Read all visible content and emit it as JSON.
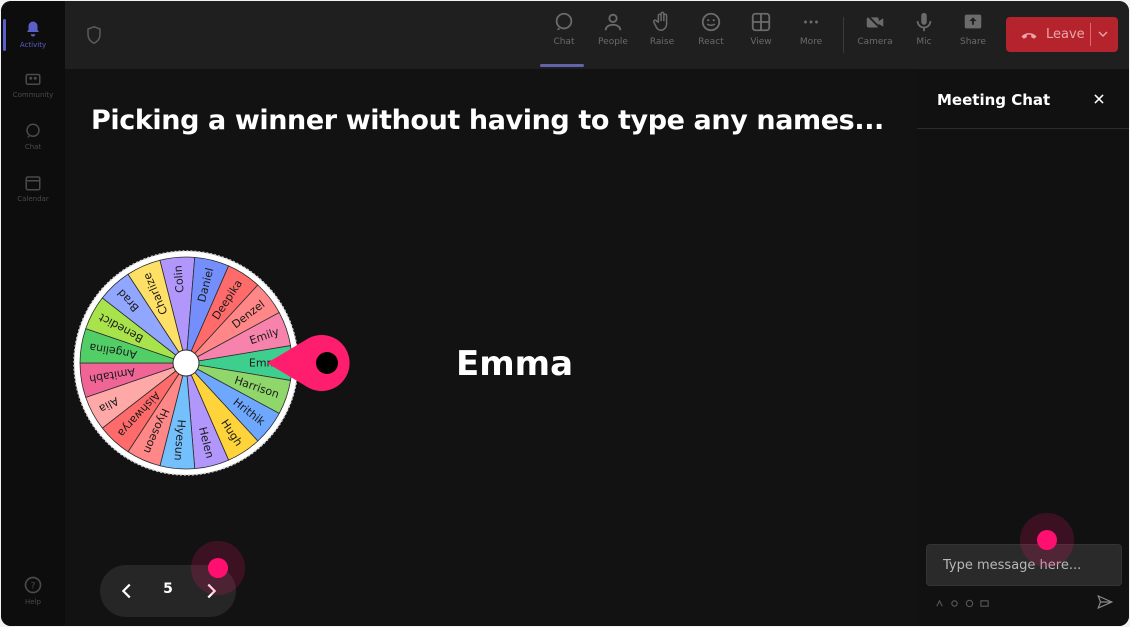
{
  "rail": {
    "items": [
      {
        "label": "Activity",
        "icon": "bell-icon",
        "active": true
      },
      {
        "label": "Community",
        "icon": "community-icon"
      },
      {
        "label": "Chat",
        "icon": "chat-icon"
      },
      {
        "label": "Calendar",
        "icon": "calendar-icon"
      }
    ],
    "help_label": "Help"
  },
  "toolbar": {
    "buttons": [
      {
        "label": "Chat",
        "icon": "chat-icon",
        "active": true
      },
      {
        "label": "People",
        "icon": "people-icon"
      },
      {
        "label": "Raise",
        "icon": "raise-hand-icon"
      },
      {
        "label": "React",
        "icon": "react-icon"
      },
      {
        "label": "View",
        "icon": "view-icon"
      },
      {
        "label": "More",
        "icon": "more-icon"
      },
      {
        "label": "Camera",
        "icon": "camera-icon"
      },
      {
        "label": "Mic",
        "icon": "mic-icon"
      },
      {
        "label": "Share",
        "icon": "share-icon"
      }
    ],
    "leave_label": "Leave",
    "leave_color": "#b5232c"
  },
  "stage": {
    "headline": "Picking a winner without having to type any names...",
    "winner": "Emma",
    "wheel": {
      "names": [
        "Emma",
        "Harrison",
        "Hrithik",
        "Hugh",
        "Helen",
        "Hyesun",
        "Hyoseon",
        "Aishwarya",
        "Alia",
        "Amitabh",
        "Angelina",
        "Benedict",
        "Brad",
        "Charlize",
        "Colin",
        "Daniel",
        "Deepika",
        "Denzel",
        "Emily"
      ],
      "colors": [
        "#3ecf8e",
        "#8fd76a",
        "#6ea8fe",
        "#ffd43b",
        "#b197fc",
        "#74c0fc",
        "#ff8787",
        "#ff6b6b",
        "#ffa8a8",
        "#f06595",
        "#51cf66",
        "#a9e34b",
        "#91a7ff",
        "#ffe066",
        "#b197fc",
        "#748ffc",
        "#ff6b6b",
        "#ff8787",
        "#f783ac"
      ],
      "pointer_color": "#ff1e6e"
    },
    "pager": {
      "page": "5"
    }
  },
  "chat": {
    "title": "Meeting Chat",
    "input_placeholder": "Type message here..."
  },
  "accent": "#ff0f6f"
}
